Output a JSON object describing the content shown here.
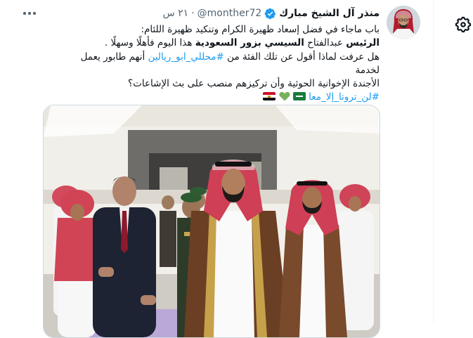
{
  "tweet": {
    "display_name": "منذر آل الشيخ مبارك",
    "handle": "@monther72",
    "dot": "·",
    "time": "٢١ س",
    "line1": "باب ماجاء في فضل إسعاد ظهيرة الكرام وتنكيد ظهيرة اللئام:",
    "line2_bold_a": "الرئيس",
    "line2_plain_a": "عبدالفتاح",
    "line2_bold_b": "السيسي بزور السعودية",
    "line2_plain_b": "هذا اليوم فأهلًا وسهلًا .",
    "line3_a": "هل عرفت لماذا أقول عن تلك الفئة من",
    "line3_link": "#محللي_ابو_ريالين",
    "line3_b": "أنهم طابور يعمل لخدمة",
    "line4": "الأجندة الإخوانية الحوثية وأن تركيزهم منصب على بث الإشاعات؟",
    "hashtag": "#لن_تروتا_إلا_معا"
  },
  "icons": {
    "avatar": "avatar-image",
    "verified": "verified-badge-icon",
    "more": "more-options-icon",
    "settings": "gear-icon",
    "flags": [
      "saudi-flag-icon",
      "green-heart-icon",
      "egypt-flag-icon"
    ]
  },
  "colors": {
    "link": "#1d9bf0",
    "muted": "#536471",
    "text": "#0f1419",
    "border": "#cfd9de"
  }
}
